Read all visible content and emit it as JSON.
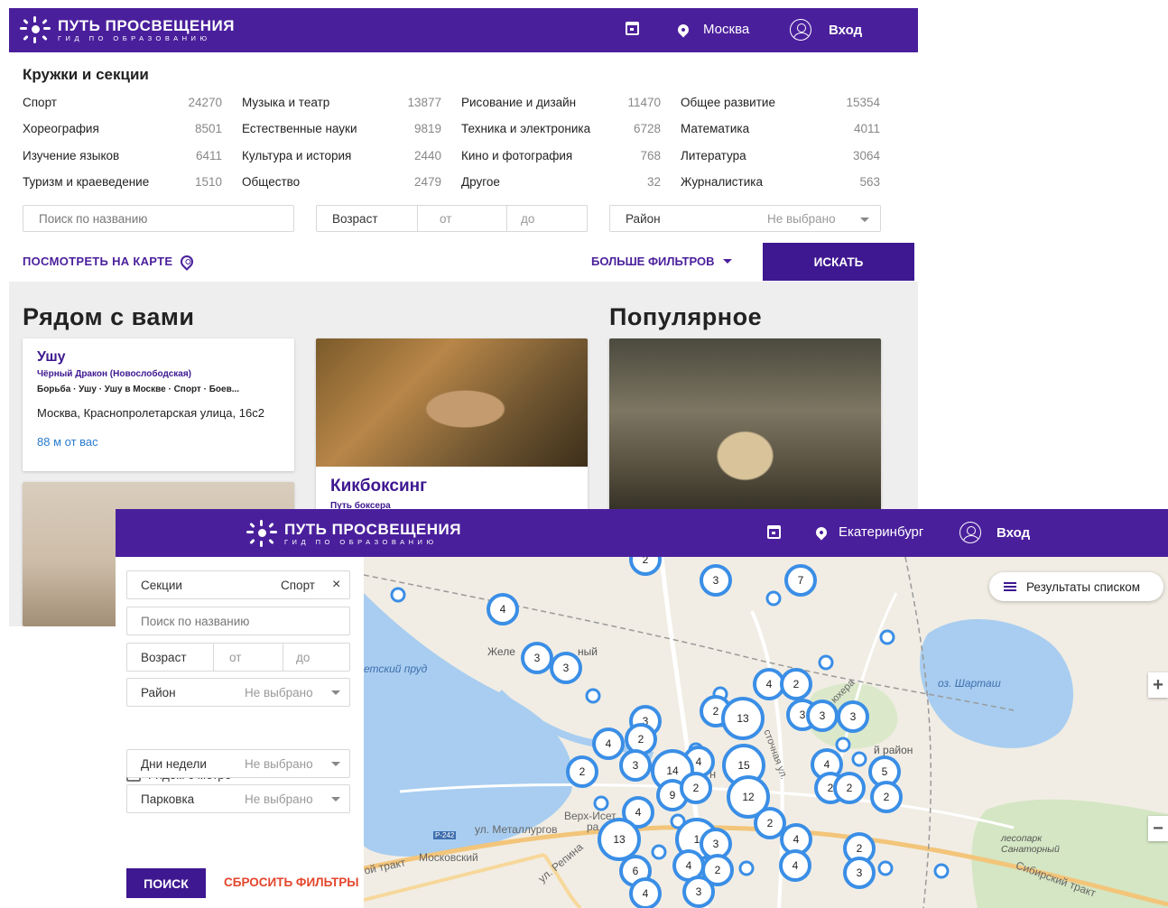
{
  "screen1": {
    "brand": {
      "title": "ПУТЬ ПРОСВЕЩЕНИЯ",
      "subtitle": "ГИД ПО ОБРАЗОВАНИЮ"
    },
    "nav": {
      "city": "Москва",
      "login": "Вход"
    },
    "section_title": "Кружки и секции",
    "categories": [
      [
        {
          "name": "Спорт",
          "count": "24270"
        },
        {
          "name": "Музыка и театр",
          "count": "13877"
        },
        {
          "name": "Рисование и дизайн",
          "count": "11470"
        },
        {
          "name": "Общее развитие",
          "count": "15354"
        }
      ],
      [
        {
          "name": "Хореография",
          "count": "8501"
        },
        {
          "name": "Естественные науки",
          "count": "9819"
        },
        {
          "name": "Техника и электроника",
          "count": "6728"
        },
        {
          "name": "Математика",
          "count": "4011"
        }
      ],
      [
        {
          "name": "Изучение языков",
          "count": "6411"
        },
        {
          "name": "Культура и история",
          "count": "2440"
        },
        {
          "name": "Кино и фотография",
          "count": "768"
        },
        {
          "name": "Литература",
          "count": "3064"
        }
      ],
      [
        {
          "name": "Туризм и краеведение",
          "count": "1510"
        },
        {
          "name": "Общество",
          "count": "2479"
        },
        {
          "name": "Другое",
          "count": "32"
        },
        {
          "name": "Журналистика",
          "count": "563"
        }
      ]
    ],
    "search_placeholder": "Поиск по названию",
    "age": {
      "label": "Возраст",
      "from": "от",
      "to": "до"
    },
    "district": {
      "label": "Район",
      "value": "Не выбрано"
    },
    "map_link": "ПОСМОТРЕТЬ НА КАРТЕ",
    "more_filters": "БОЛЬШЕ ФИЛЬТРОВ",
    "search_button": "ИСКАТЬ",
    "nearby_title": "Рядом с вами",
    "popular_title": "Популярное",
    "card1": {
      "title": "Ушу",
      "org": "Чёрный Дракон (Новослободская)",
      "tags": "Борьба · Ушу · Ушу в Москве · Спорт · Боев...",
      "address": "Москва, Краснопролетарская улица, 16с2",
      "distance": "88 м от вас"
    },
    "card2": {
      "title": "Кикбоксинг",
      "org": "Путь боксера"
    }
  },
  "screen2": {
    "brand": {
      "title": "ПУТЬ ПРОСВЕЩЕНИЯ",
      "subtitle": "ГИД ПО ОБРАЗОВАНИЮ"
    },
    "nav": {
      "city": "Екатеринбург",
      "login": "Вход"
    },
    "filters": {
      "section": {
        "label": "Секции",
        "value": "Спорт",
        "clear": "×"
      },
      "search_placeholder": "Поиск по названию",
      "age": {
        "label": "Возраст",
        "from": "от",
        "to": "до"
      },
      "district": {
        "label": "Район",
        "value": "Не выбрано"
      },
      "metro": "Рядом с метро",
      "days": {
        "label": "Дни недели",
        "value": "Не выбрано"
      },
      "parking": {
        "label": "Парковка",
        "value": "Не выбрано"
      },
      "find_button": "ПОИСК",
      "reset_link": "СБРОСИТЬ ФИЛЬТРЫ"
    },
    "map": {
      "results_button": "Результаты списком",
      "zoom_in": "+",
      "zoom_out": "−",
      "labels": {
        "pond": "етский пруд",
        "lake": "оз. Шарташ",
        "district": "й район",
        "zhel": "Желе",
        "zhel2": "ный",
        "verkh": "Верх-Исет",
        "verkh2": "ра",
        "road_metall": "ул. Металлургов",
        "road_shield": "Р-242",
        "moskovsky": "Московский",
        "trakt": "ой тракт",
        "repina": "ул. Репина",
        "stochnaya": "сточная ул.",
        "yuzhera": "юхера",
        "forest": "лесопарк Санаторный",
        "sibirsky": "Сибирский тракт",
        "n_letter": "н"
      },
      "clusters": [
        {
          "label": "3"
        },
        {
          "label": "7"
        },
        {
          "label": "4"
        },
        {
          "label": "3"
        },
        {
          "label": "3"
        },
        {
          "label": "4"
        },
        {
          "label": "2"
        },
        {
          "label": "2"
        },
        {
          "label": "13"
        },
        {
          "label": "3"
        },
        {
          "label": "3"
        },
        {
          "label": "3"
        },
        {
          "label": "3"
        },
        {
          "label": "4"
        },
        {
          "label": "2"
        },
        {
          "label": "2"
        },
        {
          "label": "3"
        },
        {
          "label": "4"
        },
        {
          "label": "14"
        },
        {
          "label": "15"
        },
        {
          "label": "4"
        },
        {
          "label": "5"
        },
        {
          "label": "9"
        },
        {
          "label": "2"
        },
        {
          "label": "12"
        },
        {
          "label": "2"
        },
        {
          "label": "2"
        },
        {
          "label": "2"
        },
        {
          "label": "4"
        },
        {
          "label": "2"
        },
        {
          "label": "13"
        },
        {
          "label": "1"
        },
        {
          "label": "3"
        },
        {
          "label": "4"
        },
        {
          "label": "2"
        },
        {
          "label": "2"
        },
        {
          "label": "6"
        },
        {
          "label": "4"
        },
        {
          "label": "4"
        },
        {
          "label": "3"
        },
        {
          "label": "4"
        },
        {
          "label": "3"
        },
        {
          "label": "2"
        }
      ]
    }
  }
}
